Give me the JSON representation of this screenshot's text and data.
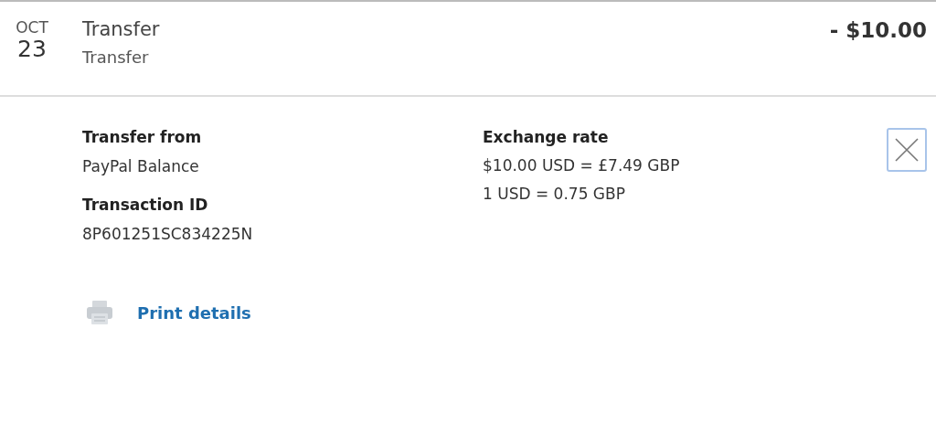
{
  "transaction": {
    "month": "OCT",
    "day": "23",
    "title": "Transfer",
    "subtitle": "Transfer",
    "amount": "- $10.00"
  },
  "details": {
    "left": [
      {
        "label": "Transfer from",
        "value": "PayPal Balance"
      },
      {
        "label": "Transaction ID",
        "value": "8P601251SC834225N"
      }
    ],
    "right": {
      "label": "Exchange rate",
      "lines": [
        "$10.00 USD = £7.49 GBP",
        "1 USD = 0.75 GBP"
      ]
    }
  },
  "print_link": "Print details"
}
